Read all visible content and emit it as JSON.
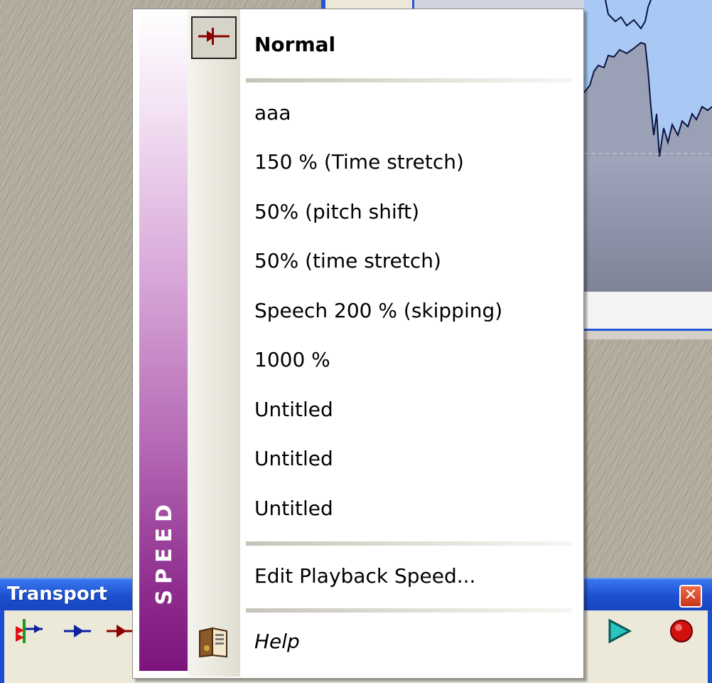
{
  "menu": {
    "sidebar_label": "SPEED",
    "items": [
      {
        "label": "Normal",
        "checked": true
      },
      {
        "label": "aaa"
      },
      {
        "label": "150 % (Time stretch)"
      },
      {
        "label": "50% (pitch shift)"
      },
      {
        "label": "50% (time stretch)"
      },
      {
        "label": "Speech 200 % (skipping)"
      },
      {
        "label": "1000 %"
      },
      {
        "label": "Untitled"
      },
      {
        "label": "Untitled"
      },
      {
        "label": "Untitled"
      }
    ],
    "edit_label": "Edit Playback Speed...",
    "help_label": "Help",
    "icons": {
      "checked": "arrow-marker-icon",
      "help": "help-book-icon"
    },
    "colors": {
      "sidebar_top": "#ffffff",
      "sidebar_bottom": "#7c147c",
      "arrow": "#8b0000"
    }
  },
  "transport": {
    "title": "Transport",
    "close_glyph": "✕",
    "buttons": [
      "speed-marker-icon",
      "blue-arrow-icon",
      "red-arrow-icon",
      "play-icon",
      "record-icon"
    ]
  }
}
